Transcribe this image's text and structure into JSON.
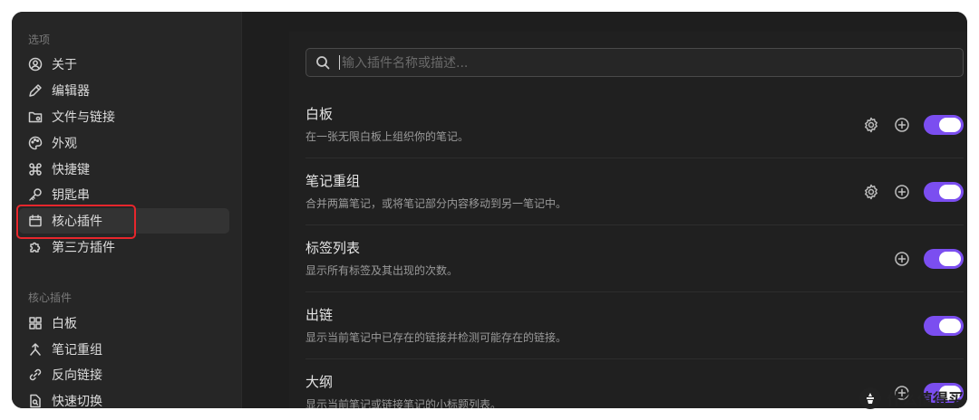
{
  "sidebar": {
    "options_section": "选项",
    "options": [
      {
        "label": "关于",
        "icon": "user-circle-icon"
      },
      {
        "label": "编辑器",
        "icon": "pencil-icon"
      },
      {
        "label": "文件与链接",
        "icon": "folder-cog-icon"
      },
      {
        "label": "外观",
        "icon": "palette-icon"
      },
      {
        "label": "快捷键",
        "icon": "command-icon"
      },
      {
        "label": "钥匙串",
        "icon": "key-icon"
      },
      {
        "label": "核心插件",
        "icon": "calendar-box-icon"
      },
      {
        "label": "第三方插件",
        "icon": "puzzle-icon"
      }
    ],
    "core_section": "核心插件",
    "core": [
      {
        "label": "白板",
        "icon": "grid-icon"
      },
      {
        "label": "笔记重组",
        "icon": "merge-arrow-icon"
      },
      {
        "label": "反向链接",
        "icon": "backlink-icon"
      },
      {
        "label": "快速切换",
        "icon": "file-search-icon"
      }
    ]
  },
  "search": {
    "placeholder": "输入插件名称或描述..."
  },
  "plugins": [
    {
      "name": "白板",
      "desc": "在一张无限白板上组织你的笔记。",
      "settings": true,
      "add": true,
      "enabled": true
    },
    {
      "name": "笔记重组",
      "desc": "合并两篇笔记，或将笔记部分内容移动到另一笔记中。",
      "settings": true,
      "add": true,
      "enabled": true
    },
    {
      "name": "标签列表",
      "desc": "显示所有标签及其出现的次数。",
      "settings": false,
      "add": true,
      "enabled": true
    },
    {
      "name": "出链",
      "desc": "显示当前笔记中已存在的链接并检测可能存在的链接。",
      "settings": false,
      "add": false,
      "enabled": true
    },
    {
      "name": "大纲",
      "desc": "显示当前笔记或链接笔记的小标题列表。",
      "settings": false,
      "add": true,
      "enabled": true
    }
  ],
  "colors": {
    "accent": "#7b4ef0",
    "highlight": "#e8262c",
    "background": "#1e1e1e"
  },
  "watermark": {
    "text": "什么值得买"
  }
}
